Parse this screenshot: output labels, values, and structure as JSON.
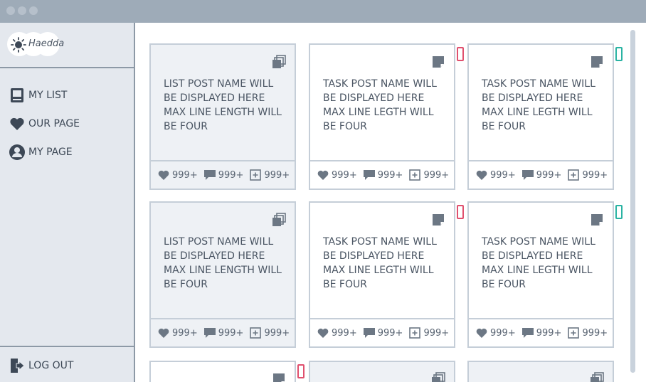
{
  "app": {
    "logo_text": "Haedda"
  },
  "sidebar": {
    "items": [
      {
        "label": "MY LIST",
        "icon": "book-icon"
      },
      {
        "label": "OUR PAGE",
        "icon": "heart-icon"
      },
      {
        "label": "MY PAGE",
        "icon": "user-icon"
      }
    ],
    "logout_label": "LOG OUT"
  },
  "colors": {
    "accent_red": "#e0506e",
    "accent_teal": "#2ab3a3",
    "icon_gray": "#6c7784"
  },
  "cards": [
    {
      "kind": "list",
      "title": "LIST POST NAME WILL BE DISPLAYED HERE MAX LINE LENGTH WILL BE FOUR",
      "likes": "999+",
      "comments": "999+",
      "adds": "999+"
    },
    {
      "kind": "task",
      "tag": "red",
      "title": "TASK POST NAME WILL BE DISPLAYED HERE MAX LINE LEGTH WILL BE FOUR",
      "likes": "999+",
      "comments": "999+",
      "adds": "999+"
    },
    {
      "kind": "task",
      "tag": "teal",
      "title": "TASK POST NAME WILL BE DISPLAYED HERE MAX LINE LEGTH WILL BE FOUR",
      "likes": "999+",
      "comments": "999+",
      "adds": "999+"
    },
    {
      "kind": "list",
      "title": "LIST POST NAME WILL BE DISPLAYED HERE MAX LINE LENGTH WILL BE FOUR",
      "likes": "999+",
      "comments": "999+",
      "adds": "999+"
    },
    {
      "kind": "task",
      "tag": "red",
      "title": "TASK POST NAME WILL BE DISPLAYED HERE MAX LINE LEGTH WILL BE FOUR",
      "likes": "999+",
      "comments": "999+",
      "adds": "999+"
    },
    {
      "kind": "task",
      "tag": "teal",
      "title": "TASK POST NAME WILL BE DISPLAYED HERE MAX LINE LEGTH WILL BE FOUR",
      "likes": "999+",
      "comments": "999+",
      "adds": "999+"
    }
  ],
  "partial_cards": [
    {
      "kind": "task",
      "tag": "red"
    },
    {
      "kind": "list"
    },
    {
      "kind": "list"
    }
  ]
}
